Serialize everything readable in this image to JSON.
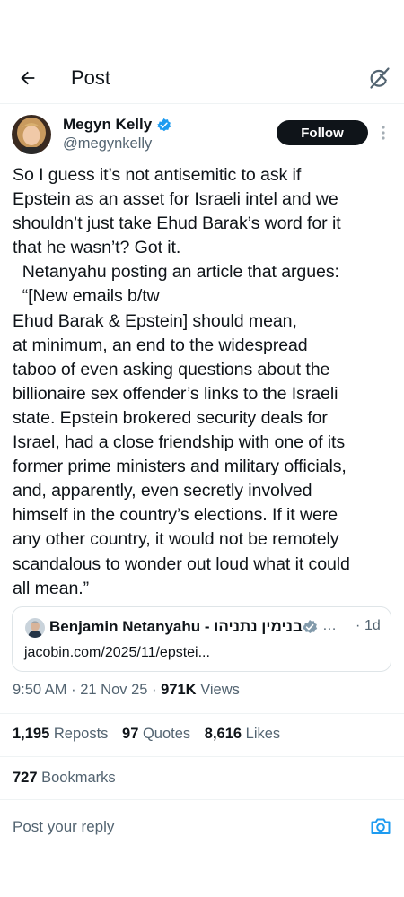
{
  "header": {
    "title": "Post",
    "back_icon": "arrow-left-icon",
    "grok_icon": "grok-icon"
  },
  "author": {
    "display_name": "Megyn Kelly",
    "handle": "@megynkelly",
    "verified": true,
    "follow_label": "Follow",
    "more_icon": "more-vertical-icon"
  },
  "tweet": {
    "lines": [
      "So I guess it’s not antisemitic to ask if",
      "Epstein as an asset for Israeli intel and we",
      "shouldn’t just take Ehud Barak’s word for it",
      "that he wasn’t? Got it.",
      "  Netanyahu posting an article that argues:",
      "  “[New emails b/tw",
      "Ehud Barak & Epstein] should mean,",
      "at minimum, an end to the widespread",
      "taboo of even asking questions about the",
      "billionaire sex offender’s links to the Israeli",
      "state. Epstein brokered security deals for",
      "Israel, had a close friendship with one of its",
      "former prime ministers and military officials,",
      "and, apparently, even secretly involved",
      "himself in the country’s elections. If it were",
      "any other country, it would not be remotely",
      "scandalous to wonder out loud what it could",
      "all mean.”"
    ]
  },
  "quote": {
    "author": "Benjamin Netanyahu - בנימין נתניהו",
    "verified_color": "gray",
    "ellipsis": "…",
    "separator": "·",
    "time": "1d",
    "link": "jacobin.com/2025/11/epstei..."
  },
  "meta": {
    "time": "9:50 AM",
    "date": "21 Nov 25",
    "separator": "·",
    "views_count": "971K",
    "views_label": "Views"
  },
  "stats": {
    "reposts_count": "1,195",
    "reposts_label": "Reposts",
    "quotes_count": "97",
    "quotes_label": "Quotes",
    "likes_count": "8,616",
    "likes_label": "Likes",
    "bookmarks_count": "727",
    "bookmarks_label": "Bookmarks"
  },
  "reply": {
    "placeholder": "Post your reply",
    "camera_icon": "camera-icon"
  },
  "colors": {
    "text": "#0f1419",
    "secondary": "#536471",
    "verified_blue": "#1d9bf0",
    "verified_gray": "#829aab",
    "divider": "#eff3f4",
    "follow_bg": "#0f1419"
  }
}
